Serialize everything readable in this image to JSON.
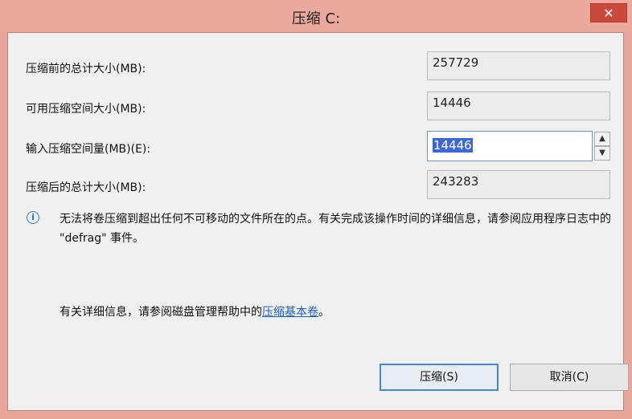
{
  "window": {
    "title": "压缩 C:",
    "close_glyph": "✕"
  },
  "fields": {
    "total_before": {
      "label": "压缩前的总计大小(MB):",
      "value": "257729"
    },
    "available": {
      "label": "可用压缩空间大小(MB):",
      "value": "14446"
    },
    "input_amount": {
      "label": "输入压缩空间量(MB)(E):",
      "value": "14446"
    },
    "total_after": {
      "label": "压缩后的总计大小(MB):",
      "value": "243283"
    }
  },
  "spinner": {
    "up": "▲",
    "down": "▼"
  },
  "info": {
    "icon": "info-icon",
    "text": "无法将卷压缩到超出任何不可移动的文件所在的点。有关完成该操作时间的详细信息，请参阅应用程序日志中的 \"defrag\" 事件。"
  },
  "help": {
    "prefix": "有关详细信息，请参阅磁盘管理帮助中的",
    "link": "压缩基本卷",
    "suffix": "。"
  },
  "buttons": {
    "compress": "压缩(S)",
    "cancel": "取消(C)"
  },
  "colors": {
    "titlebar": "#eba89d",
    "close": "#c9493b",
    "selection": "#3a67d5",
    "link": "#1d5fbf"
  }
}
